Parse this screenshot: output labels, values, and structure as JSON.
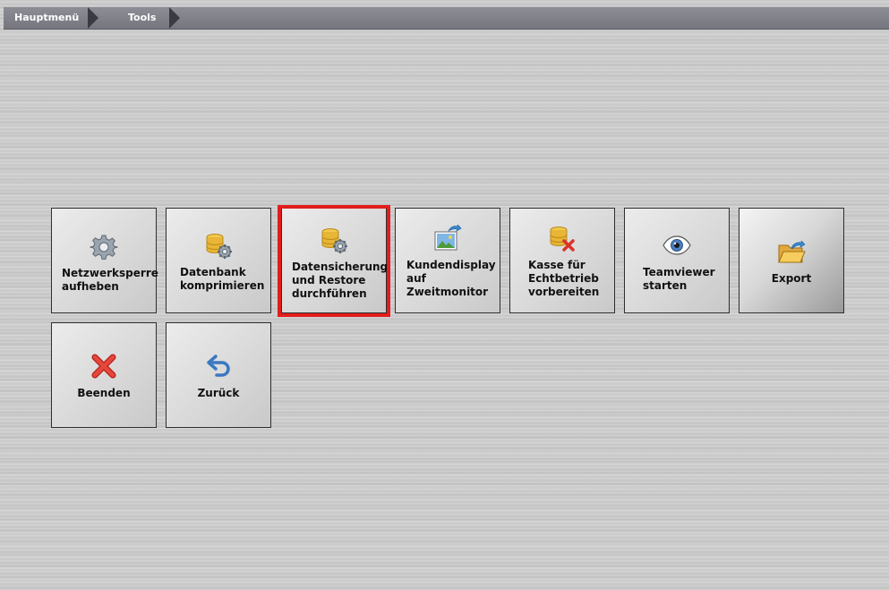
{
  "breadcrumb": {
    "items": [
      "Hauptmenü",
      "Tools"
    ]
  },
  "tiles": [
    {
      "label": "Netzwerksperre aufheben",
      "icon": "gear-icon"
    },
    {
      "label": "Datenbank komprimieren",
      "icon": "database-gear-icon"
    },
    {
      "label": "Datensicherung und Restore durchführen",
      "icon": "database-gear-icon"
    },
    {
      "label": "Kundendisplay auf Zweitmonitor",
      "icon": "image-export-icon"
    },
    {
      "label": "Kasse für Echtbetrieb vorbereiten",
      "icon": "database-delete-icon"
    },
    {
      "label": "Teamviewer starten",
      "icon": "eye-icon"
    },
    {
      "label": "Export",
      "icon": "folder-export-icon"
    },
    {
      "label": "Beenden",
      "icon": "close-icon"
    },
    {
      "label": "Zurück",
      "icon": "undo-arrow-icon"
    }
  ],
  "colors": {
    "highlight": "#e31c1c",
    "breadcrumb_bg": "#82828b",
    "close_icon": "#d9342b",
    "undo_icon": "#3a78c2"
  }
}
